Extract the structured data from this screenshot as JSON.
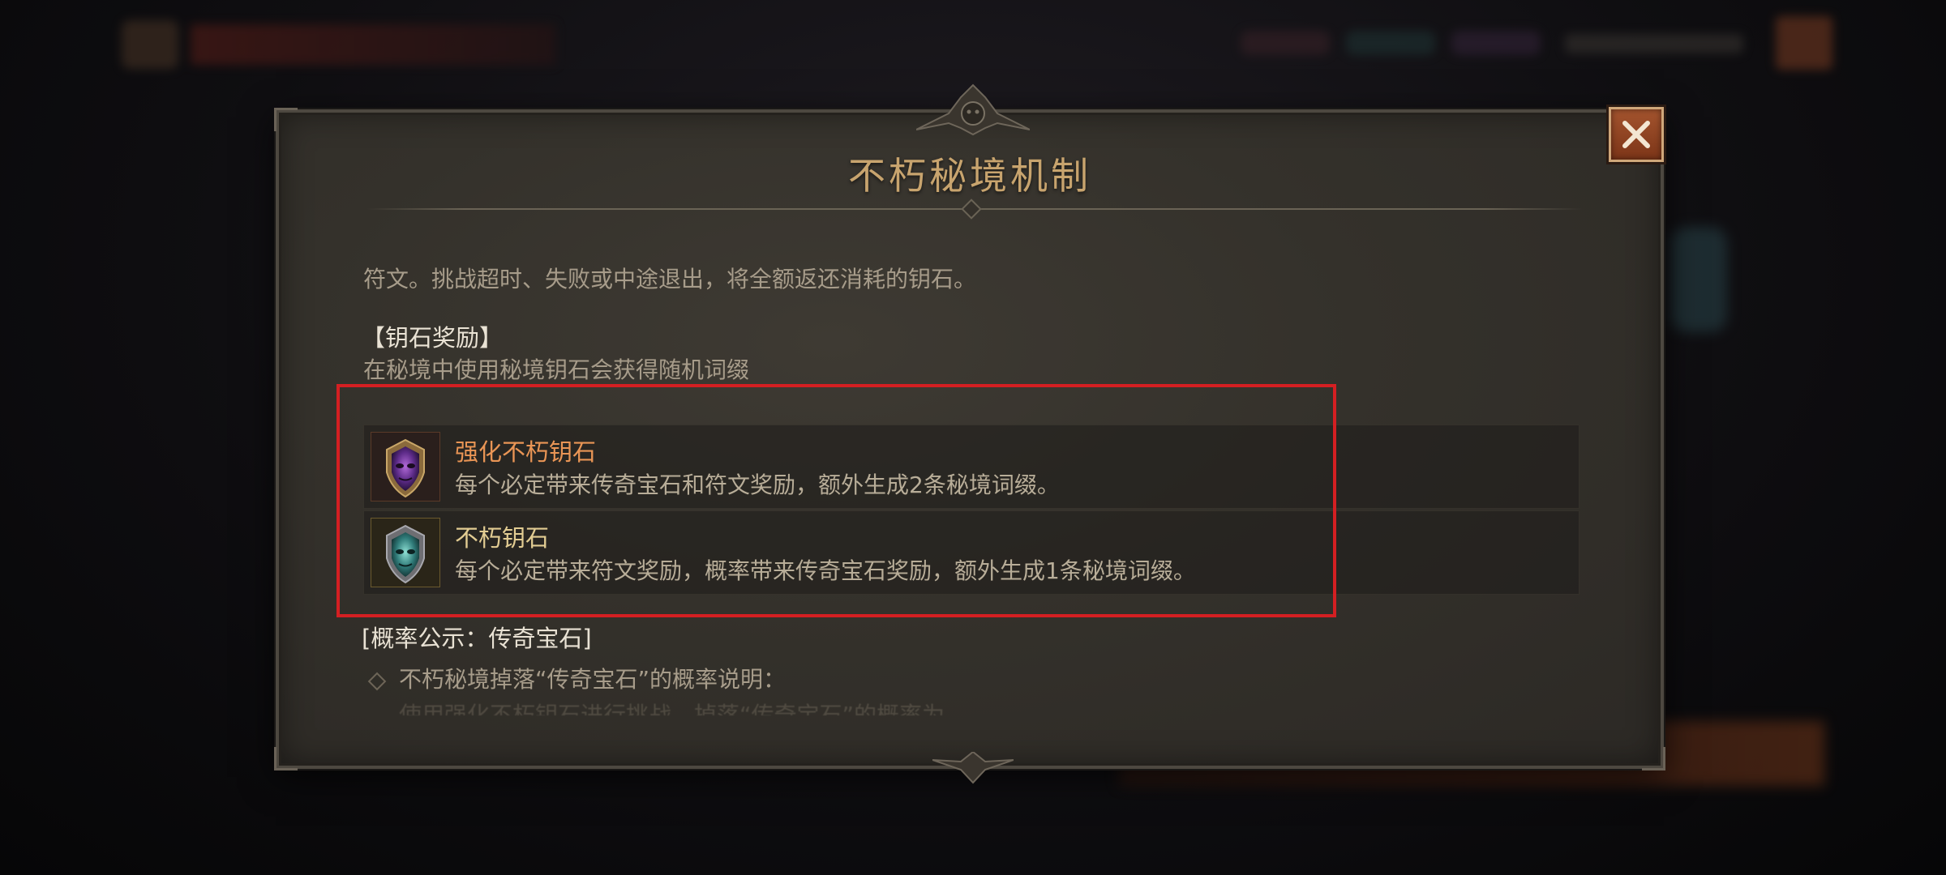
{
  "dialog": {
    "title": "不朽秘境机制",
    "intro_text": "符文。挑战超时、失败或中途退出，将全额返还消耗的钥石。",
    "keystone_section": {
      "heading": "【钥石奖励】",
      "subtext": "在秘境中使用秘境钥石会获得随机词缀",
      "items": [
        {
          "name": "强化不朽钥石",
          "description": "每个必定带来传奇宝石和符文奖励，额外生成2条秘境词缀。",
          "name_color": "#e99555",
          "icon": "purple-mask-keystone-icon"
        },
        {
          "name": "不朽钥石",
          "description": "每个必定带来符文奖励，概率带来传奇宝石奖励，额外生成1条秘境词缀。",
          "name_color": "#e2cc92",
          "icon": "teal-mask-keystone-icon"
        }
      ]
    },
    "probability_section": {
      "heading": "[概率公示：传奇宝石]",
      "bullet_text": "不朽秘境掉落“传奇宝石”的概率说明：",
      "faded_text": "使用强化不朽钥石进行挑战，掉落“传奇宝石”的概率为"
    }
  },
  "colors": {
    "title": "#c8a46e",
    "highlight_border": "#d41f22",
    "close_button": "#8e4320"
  }
}
